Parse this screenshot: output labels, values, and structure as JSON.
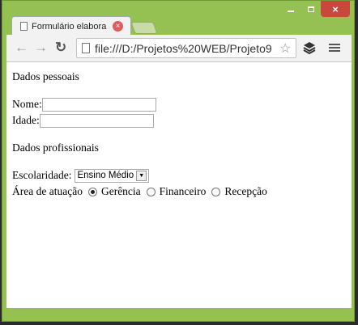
{
  "browser": {
    "tab_title": "Formulário elabora",
    "url": "file:///D:/Projetos%20WEB/Projeto9",
    "close_glyph": "×"
  },
  "form": {
    "section_personal": "Dados pessoais",
    "name_label": "Nome:",
    "age_label": "Idade:",
    "name_value": "",
    "age_value": "",
    "section_professional": "Dados profissionais",
    "education_label": "Escolaridade:",
    "education_selected": "Ensino Médio",
    "area_label": "Área de atuação",
    "area_options": [
      "Gerência",
      "Financeiro",
      "Recepção"
    ],
    "area_selected": "Gerência"
  }
}
